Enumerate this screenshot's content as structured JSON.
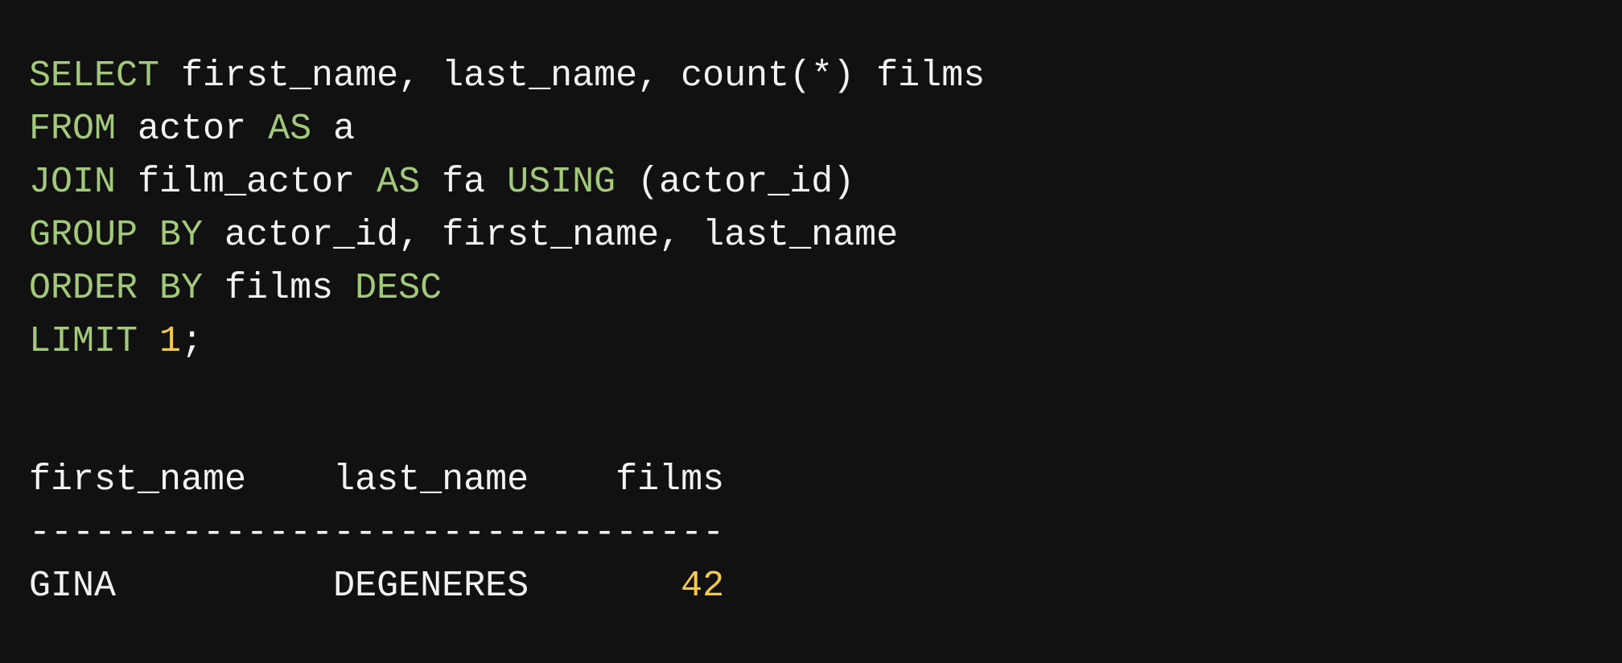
{
  "colors": {
    "background": "#111111",
    "keyword": "#a3c97a",
    "number": "#f2c94c",
    "text": "#f2f2f2"
  },
  "query": {
    "lines": [
      [
        {
          "t": "SELECT",
          "k": "kw"
        },
        {
          "t": " first_name, last_name, count(*) films",
          "k": "txt"
        }
      ],
      [
        {
          "t": "FROM",
          "k": "kw"
        },
        {
          "t": " actor ",
          "k": "txt"
        },
        {
          "t": "AS",
          "k": "kw"
        },
        {
          "t": " a",
          "k": "txt"
        }
      ],
      [
        {
          "t": "JOIN",
          "k": "kw"
        },
        {
          "t": " film_actor ",
          "k": "txt"
        },
        {
          "t": "AS",
          "k": "kw"
        },
        {
          "t": " fa ",
          "k": "txt"
        },
        {
          "t": "USING",
          "k": "kw"
        },
        {
          "t": " (actor_id)",
          "k": "txt"
        }
      ],
      [
        {
          "t": "GROUP BY",
          "k": "kw"
        },
        {
          "t": " actor_id, first_name, last_name",
          "k": "txt"
        }
      ],
      [
        {
          "t": "ORDER BY",
          "k": "kw"
        },
        {
          "t": " films ",
          "k": "txt"
        },
        {
          "t": "DESC",
          "k": "kw"
        }
      ],
      [
        {
          "t": "LIMIT",
          "k": "kw"
        },
        {
          "t": " ",
          "k": "txt"
        },
        {
          "t": "1",
          "k": "num"
        },
        {
          "t": ";",
          "k": "txt"
        }
      ]
    ]
  },
  "result": {
    "columns": [
      "first_name",
      "last_name",
      "films"
    ],
    "separator": "--------------------------------",
    "rows": [
      {
        "first_name": "GINA",
        "last_name": "DEGENERES",
        "films": "42"
      }
    ]
  }
}
